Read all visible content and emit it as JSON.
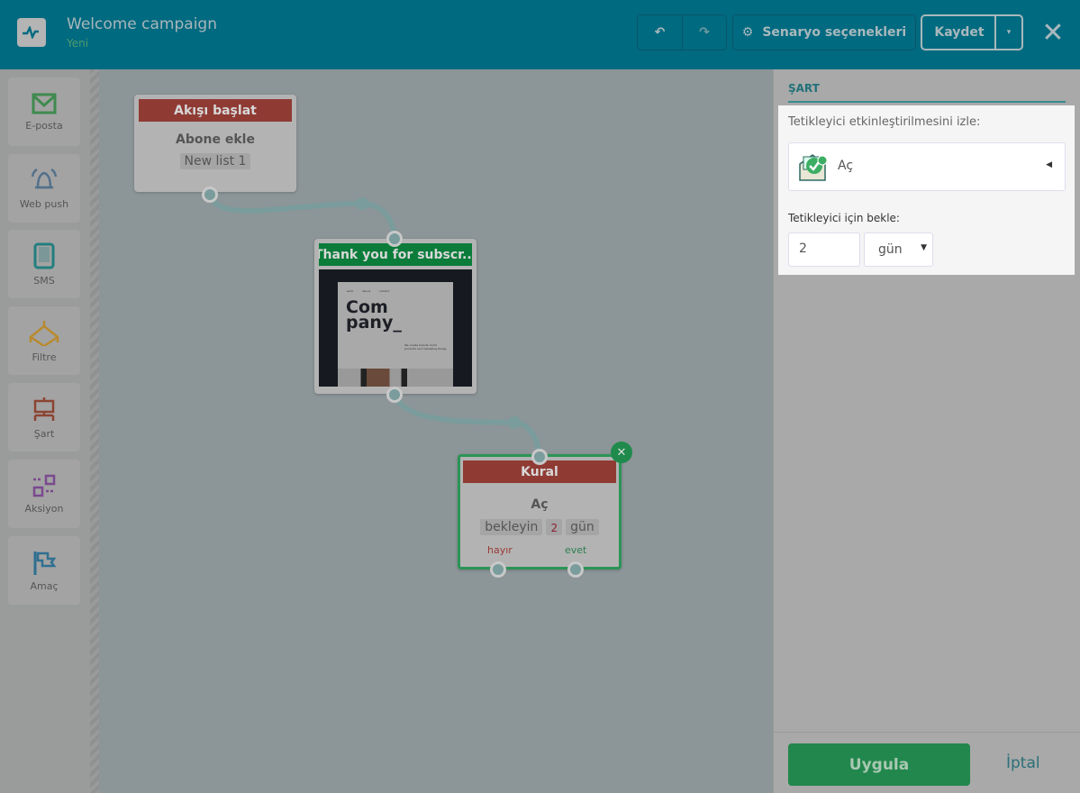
{
  "header": {
    "title": "Welcome campaign",
    "status": "Yeni",
    "undo": "undo-icon",
    "redo": "redo-icon",
    "options_label": "Senaryo seçenekleri",
    "save_label": "Kaydet",
    "close": "close-icon"
  },
  "sidebar": {
    "items": [
      {
        "label": "E-posta",
        "icon": "envelope-icon",
        "color": "#3f8a4e"
      },
      {
        "label": "Web push",
        "icon": "bell-icon",
        "color": "#54718a"
      },
      {
        "label": "SMS",
        "icon": "tablet-icon",
        "color": "#237e7e"
      },
      {
        "label": "Filtre",
        "icon": "filter-branch-icon",
        "color": "#b98a2e"
      },
      {
        "label": "Şart",
        "icon": "condition-robot-icon",
        "color": "#8c4433"
      },
      {
        "label": "Aksiyon",
        "icon": "action-arrows-icon",
        "color": "#7a4a8e"
      },
      {
        "label": "Amaç",
        "icon": "goal-flag-icon",
        "color": "#2f6f90"
      }
    ]
  },
  "canvas": {
    "start": {
      "header": "Akışı başlat",
      "title": "Abone ekle",
      "tag": "New list 1"
    },
    "email": {
      "header": "Thank you for subscr...",
      "preview_nav": [
        "work",
        "about",
        "contact"
      ],
      "preview_heading": [
        "Com",
        "pany_"
      ],
      "preview_text": "We create brands, build products and marketing things."
    },
    "rule": {
      "header": "Kural",
      "title": "Aç",
      "wait_label": "bekleyin",
      "wait_value": "2",
      "wait_unit": "gün",
      "no_label": "hayır",
      "yes_label": "evet"
    }
  },
  "panel": {
    "section_title": "ŞART",
    "trigger_label": "Tetikleyici etkinleştirilmesini izle:",
    "trigger_value": "Aç",
    "wait_label": "Tetikleyici için bekle:",
    "wait_value": "2",
    "wait_unit": "gün",
    "apply_label": "Uygula",
    "cancel_label": "İptal"
  }
}
